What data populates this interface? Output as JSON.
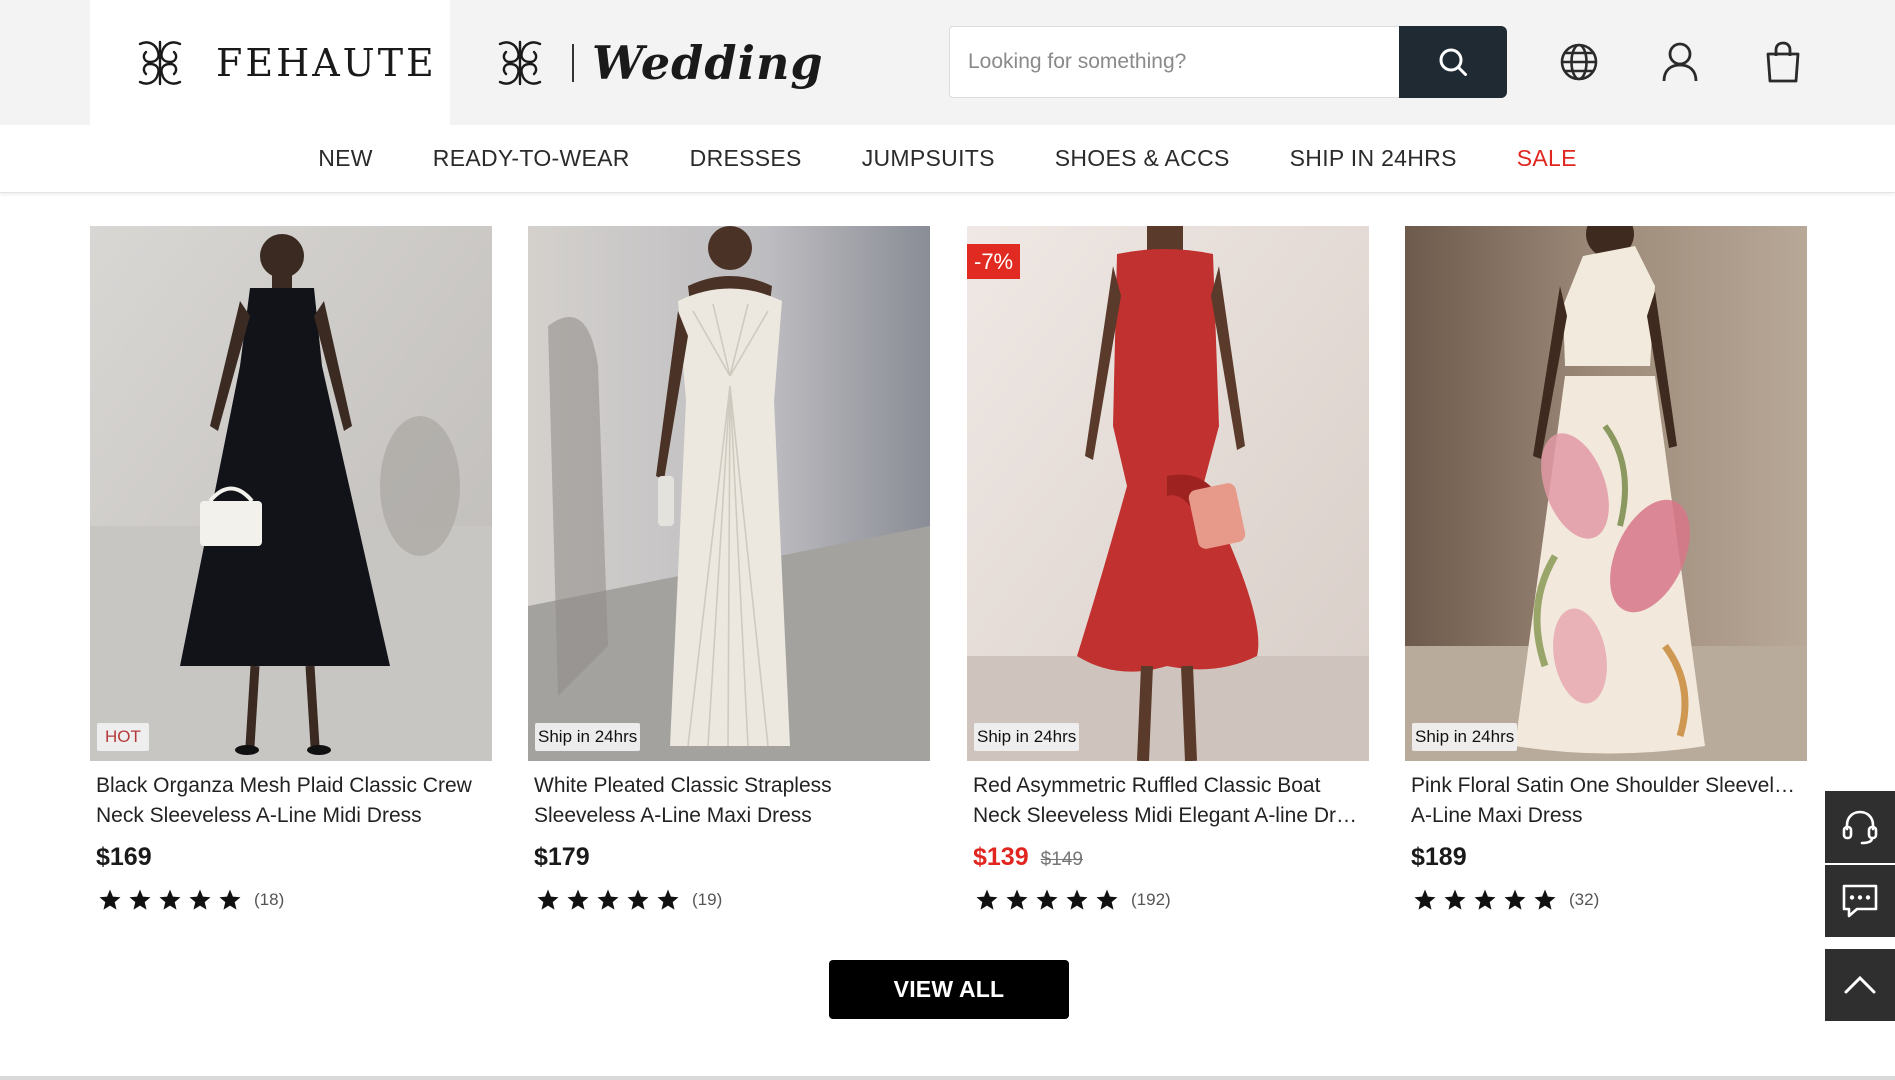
{
  "header": {
    "brand_name": "FEHAUTE",
    "wedding_name": "Wedding",
    "search_placeholder": "Looking for something?"
  },
  "nav": {
    "items": [
      {
        "label": "NEW"
      },
      {
        "label": "READY-TO-WEAR"
      },
      {
        "label": "DRESSES"
      },
      {
        "label": "JUMPSUITS"
      },
      {
        "label": "SHOES & ACCS"
      },
      {
        "label": "SHIP IN 24HRS"
      },
      {
        "label": "SALE"
      }
    ]
  },
  "products": [
    {
      "title_line1": "Black Organza Mesh Plaid Classic Crew",
      "title_line2": "Neck Sleeveless A-Line Midi Dress",
      "price": "$169",
      "old_price": "",
      "top_badge": "",
      "bottom_badge": "HOT",
      "rating_count": "(18)",
      "rating": 5,
      "dress_color": "#101216"
    },
    {
      "title_line1": "White Pleated Classic Strapless",
      "title_line2": "Sleeveless A-Line Maxi Dress",
      "price": "$179",
      "old_price": "",
      "top_badge": "",
      "bottom_badge": "Ship in 24hrs",
      "rating_count": "(19)",
      "rating": 5,
      "dress_color": "#ece8df"
    },
    {
      "title_line1": "Red Asymmetric Ruffled Classic Boat",
      "title_line2": "Neck Sleeveless Midi Elegant A-line Dre...",
      "price": "$139",
      "old_price": "$149",
      "top_badge": "-7%",
      "bottom_badge": "Ship in 24hrs",
      "rating_count": "(192)",
      "rating": 5,
      "dress_color": "#c0312f"
    },
    {
      "title_line1": "Pink Floral Satin One Shoulder Sleeveless",
      "title_line2": "A-Line Maxi Dress",
      "price": "$189",
      "old_price": "",
      "top_badge": "",
      "bottom_badge": "Ship in 24hrs",
      "rating_count": "(32)",
      "rating": 5,
      "dress_color": "#f2e9dc"
    }
  ],
  "view_all_label": "VIEW ALL",
  "icons": {
    "search": "search-icon",
    "language": "globe-icon",
    "account": "user-icon",
    "cart": "shopping-bag-icon",
    "support": "headset-icon",
    "chat": "chat-icon",
    "back_to_top": "chevron-up-icon"
  },
  "colors": {
    "sale_red": "#e0261f",
    "header_bg": "#f3f3f3",
    "search_button": "#1f2a33",
    "float_button": "#2f2f2f"
  }
}
